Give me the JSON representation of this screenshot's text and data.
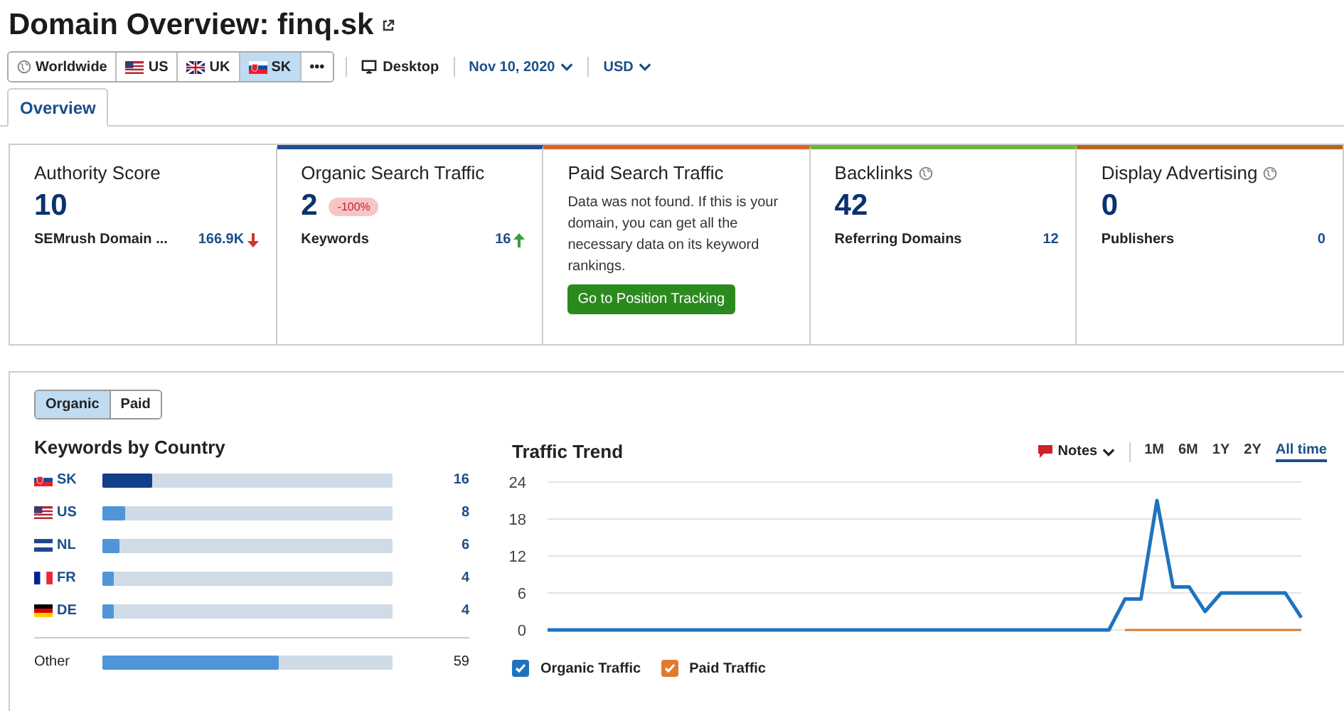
{
  "title": "Domain Overview: finq.sk",
  "databases": [
    {
      "label": "Worldwide",
      "kind": "globe",
      "selected": false
    },
    {
      "label": "US",
      "kind": "us",
      "selected": false
    },
    {
      "label": "UK",
      "kind": "uk",
      "selected": false
    },
    {
      "label": "SK",
      "kind": "sk",
      "selected": true
    },
    {
      "label": "•••",
      "kind": "more",
      "selected": false
    }
  ],
  "device": "Desktop",
  "date": "Nov 10, 2020",
  "currency": "USD",
  "tabs": [
    {
      "label": "Overview",
      "selected": true
    }
  ],
  "cards": [
    {
      "kind": "metric",
      "title": "Authority Score",
      "value": "10",
      "sub_label": "SEMrush Domain ...",
      "sub_value": "166.9K",
      "trend": {
        "kind": "down",
        "color": "#d0342c"
      }
    },
    {
      "kind": "metric",
      "title": "Organic Search Traffic",
      "color": "#1f4e96",
      "value": "2",
      "badge": "-100%",
      "sub_label": "Keywords",
      "sub_value": "16",
      "trend": {
        "kind": "up",
        "color": "#3a9c3a"
      }
    },
    {
      "kind": "message",
      "title": "Paid Search Traffic",
      "color": "#e0622a",
      "message": "Data was not found. If this is your domain, you can get all the necessary data on its keyword rankings.",
      "button": "Go to Position Tracking"
    },
    {
      "kind": "metric",
      "title": "Backlinks",
      "globe": true,
      "color": "#6db33f",
      "value": "42",
      "sub_label": "Referring Domains",
      "sub_value": "12"
    },
    {
      "kind": "metric",
      "title": "Display Advertising",
      "globe": true,
      "color": "#b5651d",
      "value": "0",
      "sub_label": "Publishers",
      "sub_value": "0"
    }
  ],
  "traffic_types": [
    {
      "label": "Organic",
      "selected": true
    },
    {
      "label": "Paid",
      "selected": false
    }
  ],
  "keywords_by_country": {
    "title": "Keywords by Country",
    "rows": [
      {
        "country": "SK",
        "kind": "sk",
        "level": 0.17,
        "value": "16"
      },
      {
        "country": "US",
        "kind": "us",
        "level": 0.08,
        "value": "8"
      },
      {
        "country": "NL",
        "kind": "nl",
        "level": 0.06,
        "value": "6"
      },
      {
        "country": "FR",
        "kind": "fr",
        "level": 0.04,
        "value": "4"
      },
      {
        "country": "DE",
        "kind": "de",
        "level": 0.04,
        "value": "4"
      }
    ],
    "other": {
      "country": "Other",
      "level": 0.61,
      "value": "59"
    }
  },
  "traffic_trend": {
    "title": "Traffic Trend",
    "notes": "Notes",
    "periods": [
      {
        "label": "1M",
        "selected": false
      },
      {
        "label": "6M",
        "selected": false
      },
      {
        "label": "1Y",
        "selected": false
      },
      {
        "label": "2Y",
        "selected": false
      },
      {
        "label": "All time",
        "selected": true
      }
    ],
    "chart_data": {
      "type": "line",
      "grid": true,
      "ylim": [
        0,
        24
      ],
      "yticks": [
        0,
        6,
        12,
        18,
        24
      ],
      "series": [
        {
          "name": "Organic Traffic",
          "color": "#1e73be",
          "values": [
            0,
            0,
            0,
            0,
            0,
            0,
            0,
            0,
            0,
            0,
            0,
            0,
            0,
            0,
            0,
            0,
            0,
            0,
            0,
            0,
            0,
            0,
            0,
            0,
            0,
            0,
            0,
            0,
            0,
            0,
            0,
            0,
            0,
            0,
            0,
            0,
            5,
            5,
            21,
            7,
            7,
            3,
            6,
            6,
            6,
            6,
            6,
            2
          ]
        },
        {
          "name": "Paid Traffic",
          "color": "#e07a2e",
          "values": [
            null,
            null,
            null,
            null,
            null,
            null,
            null,
            null,
            null,
            null,
            null,
            null,
            null,
            null,
            null,
            null,
            null,
            null,
            null,
            null,
            null,
            null,
            null,
            null,
            null,
            null,
            null,
            null,
            null,
            null,
            null,
            null,
            null,
            null,
            null,
            null,
            0,
            0,
            0,
            0,
            0,
            0,
            0,
            0,
            0,
            0,
            0,
            0
          ]
        }
      ]
    },
    "legend": [
      {
        "checked": true
      },
      {
        "checked": true
      }
    ]
  }
}
